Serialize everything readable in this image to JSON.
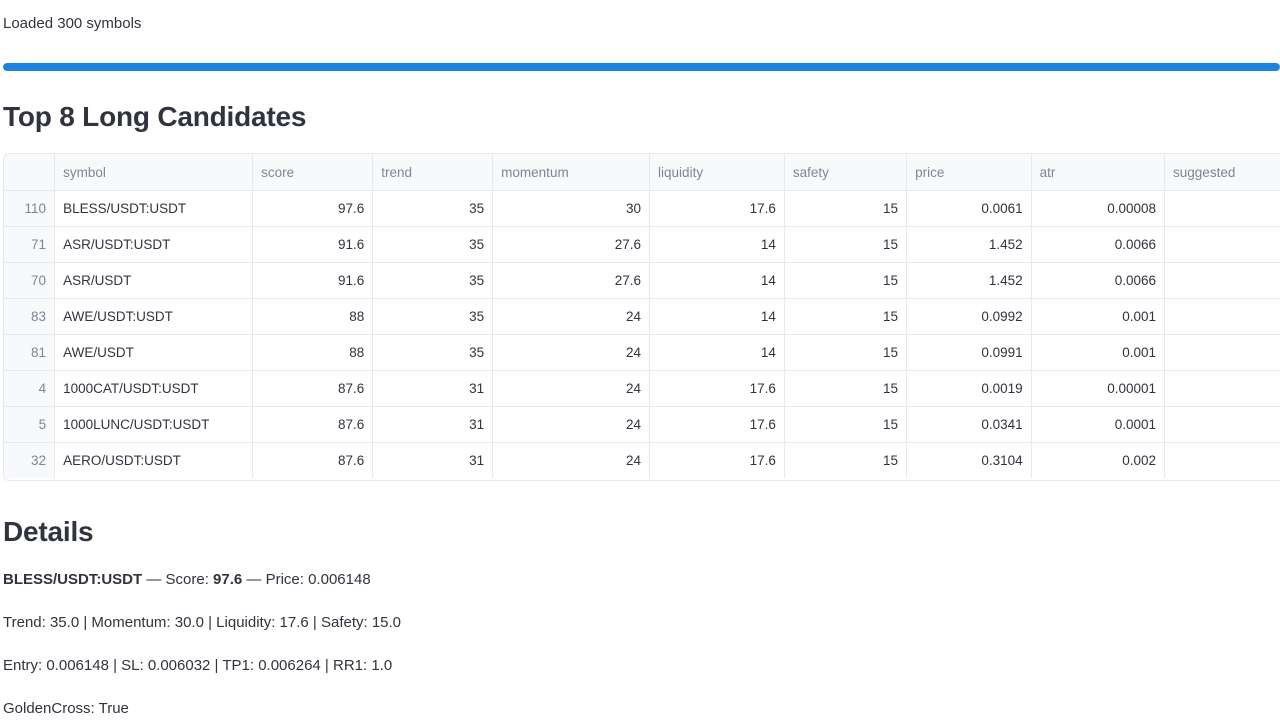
{
  "status": {
    "text": "Loaded 300 symbols"
  },
  "progress": {
    "value_percent": 100,
    "color": "#1c83e1"
  },
  "top_section": {
    "title": "Top 8 Long Candidates"
  },
  "table": {
    "columns": [
      "",
      "symbol",
      "score",
      "trend",
      "momentum",
      "liquidity",
      "safety",
      "price",
      "atr",
      "suggested"
    ],
    "rows": [
      {
        "index": "110",
        "symbol": "BLESS/USDT:USDT",
        "score": "97.6",
        "trend": "35",
        "momentum": "30",
        "liquidity": "17.6",
        "safety": "15",
        "price": "0.0061",
        "atr": "0.00008",
        "suggested": ""
      },
      {
        "index": "71",
        "symbol": "ASR/USDT:USDT",
        "score": "91.6",
        "trend": "35",
        "momentum": "27.6",
        "liquidity": "14",
        "safety": "15",
        "price": "1.452",
        "atr": "0.0066",
        "suggested": ""
      },
      {
        "index": "70",
        "symbol": "ASR/USDT",
        "score": "91.6",
        "trend": "35",
        "momentum": "27.6",
        "liquidity": "14",
        "safety": "15",
        "price": "1.452",
        "atr": "0.0066",
        "suggested": ""
      },
      {
        "index": "83",
        "symbol": "AWE/USDT:USDT",
        "score": "88",
        "trend": "35",
        "momentum": "24",
        "liquidity": "14",
        "safety": "15",
        "price": "0.0992",
        "atr": "0.001",
        "suggested": ""
      },
      {
        "index": "81",
        "symbol": "AWE/USDT",
        "score": "88",
        "trend": "35",
        "momentum": "24",
        "liquidity": "14",
        "safety": "15",
        "price": "0.0991",
        "atr": "0.001",
        "suggested": ""
      },
      {
        "index": "4",
        "symbol": "1000CAT/USDT:USDT",
        "score": "87.6",
        "trend": "31",
        "momentum": "24",
        "liquidity": "17.6",
        "safety": "15",
        "price": "0.0019",
        "atr": "0.00001",
        "suggested": ""
      },
      {
        "index": "5",
        "symbol": "1000LUNC/USDT:USDT",
        "score": "87.6",
        "trend": "31",
        "momentum": "24",
        "liquidity": "17.6",
        "safety": "15",
        "price": "0.0341",
        "atr": "0.0001",
        "suggested": ""
      },
      {
        "index": "32",
        "symbol": "AERO/USDT:USDT",
        "score": "87.6",
        "trend": "31",
        "momentum": "24",
        "liquidity": "17.6",
        "safety": "15",
        "price": "0.3104",
        "atr": "0.002",
        "suggested": ""
      }
    ]
  },
  "details": {
    "title": "Details",
    "symbol": "BLESS/USDT:USDT",
    "score_label": " — Score: ",
    "score": "97.6",
    "price_text": " — Price: 0.006148",
    "line2": "Trend: 35.0 | Momentum: 30.0 | Liquidity: 17.6 | Safety: 15.0",
    "line3": "Entry: 0.006148 | SL: 0.006032 | TP1: 0.006264 | RR1: 1.0",
    "line4": "GoldenCross: True"
  }
}
